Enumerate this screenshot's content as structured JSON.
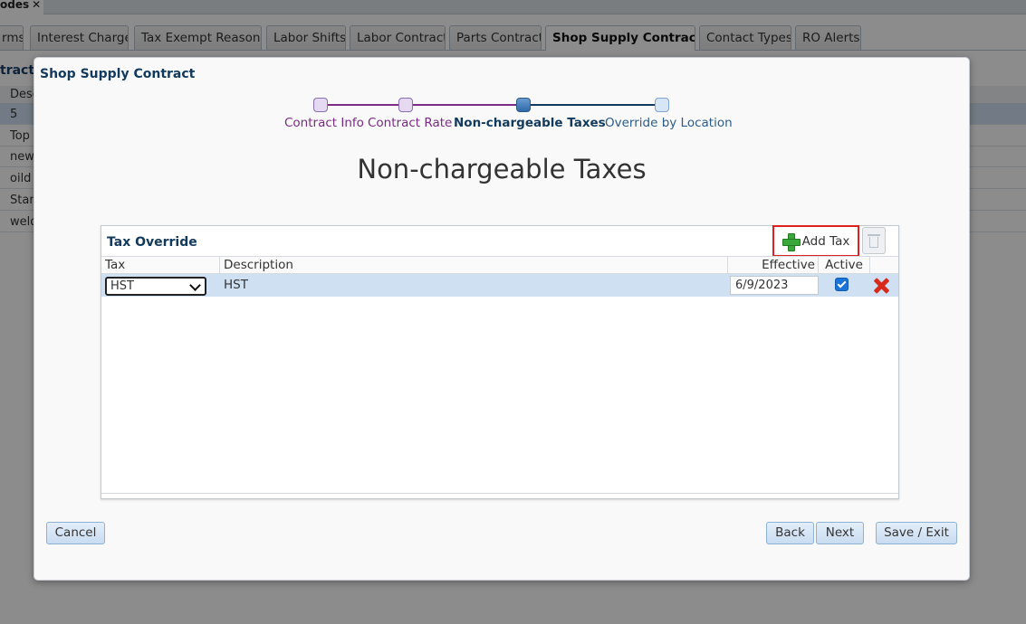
{
  "background": {
    "window_tab": "odes",
    "close_glyph": "✕",
    "tabs": [
      {
        "label": "rms"
      },
      {
        "label": "Interest Charge"
      },
      {
        "label": "Tax Exempt Reasons"
      },
      {
        "label": "Labor Shifts"
      },
      {
        "label": "Labor Contract"
      },
      {
        "label": "Parts Contract"
      },
      {
        "label": "Shop Supply Contract"
      },
      {
        "label": "Contact Types"
      },
      {
        "label": "RO Alerts"
      }
    ],
    "section_title": "tract",
    "column_header": "Desc",
    "rows": [
      "5",
      "Top",
      "new",
      "oild",
      "Stan",
      "weld"
    ]
  },
  "dialog": {
    "title": "Shop Supply Contract",
    "steps": [
      {
        "label": "Contract Info",
        "state": "done"
      },
      {
        "label": "Contract Rate",
        "state": "done"
      },
      {
        "label": "Non-chargeable Taxes",
        "state": "current"
      },
      {
        "label": "Override by Location",
        "state": "todo"
      }
    ],
    "heading": "Non-chargeable Taxes",
    "panel": {
      "title": "Tax Override",
      "add_button_label": "Add Tax",
      "columns": {
        "tax": "Tax",
        "description": "Description",
        "effective": "Effective",
        "active": "Active"
      },
      "rows": [
        {
          "tax": "HST",
          "description": "HST",
          "effective": "6/9/2023",
          "active": true
        }
      ]
    },
    "buttons": {
      "cancel": "Cancel",
      "back": "Back",
      "next": "Next",
      "save_exit": "Save / Exit"
    }
  },
  "colors": {
    "step_done": "#7b2a85",
    "step_current": "#123a5e",
    "step_todo": "#2b5c8a",
    "highlight_border": "#e02020",
    "selected_row": "#cfe0f2"
  }
}
